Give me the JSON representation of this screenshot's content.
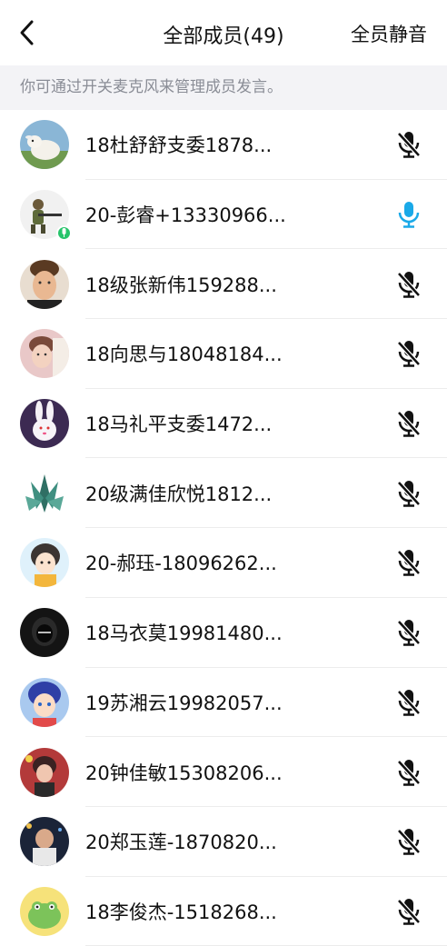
{
  "header": {
    "title": "全部成员(49)",
    "mute_all_label": "全员静音"
  },
  "hint": "你可通过开关麦克风来管理成员发言。",
  "colors": {
    "hint_bg": "#f3f3f6",
    "mic_active": "#1aa9e8",
    "mic_muted": "#111111",
    "speaking_badge": "#27c46b"
  },
  "members": [
    {
      "name": "18杜舒舒支委1878...",
      "mic": "muted",
      "avatar": "lamb-photo"
    },
    {
      "name": "20-彭睿+13330966...",
      "mic": "active",
      "avatar": "soldier-figure",
      "speaking": true
    },
    {
      "name": "18级张新伟159288...",
      "mic": "muted",
      "avatar": "man-portrait"
    },
    {
      "name": "18向思与18048184...",
      "mic": "muted",
      "avatar": "child-photo"
    },
    {
      "name": "18马礼平支委1472...",
      "mic": "muted",
      "avatar": "rabbit-cartoon"
    },
    {
      "name": "20级满佳欣悦1812...",
      "mic": "muted",
      "avatar": "crystal-art"
    },
    {
      "name": "20-郝珏-18096262...",
      "mic": "muted",
      "avatar": "anime-girl"
    },
    {
      "name": "18马衣莫19981480...",
      "mic": "muted",
      "avatar": "dark-hood"
    },
    {
      "name": "19苏湘云19982057...",
      "mic": "muted",
      "avatar": "anime-boy"
    },
    {
      "name": "20钟佳敏15308206...",
      "mic": "muted",
      "avatar": "red-photo"
    },
    {
      "name": "20郑玉莲-1870820...",
      "mic": "muted",
      "avatar": "night-photo"
    },
    {
      "name": "18李俊杰-1518268...",
      "mic": "muted",
      "avatar": "frog-cartoon"
    }
  ]
}
